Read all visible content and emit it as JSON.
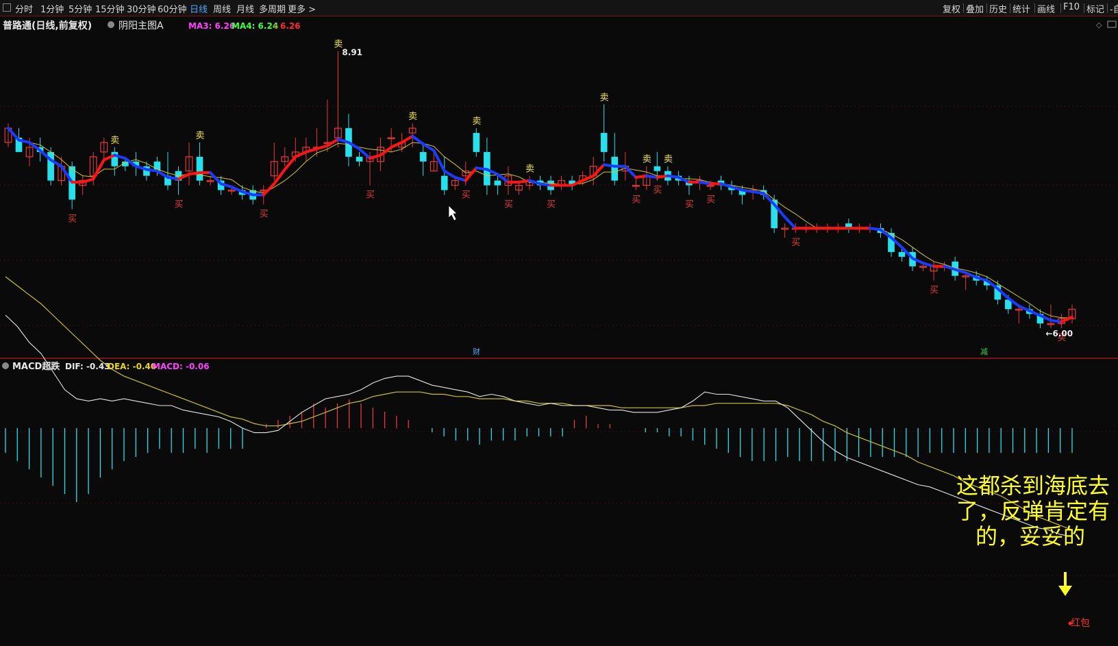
{
  "toolbar": {
    "periods": [
      "分时",
      "1分钟",
      "5分钟",
      "15分钟",
      "30分钟",
      "60分钟",
      "日线",
      "周线",
      "月线",
      "多周期",
      "更多 >"
    ],
    "active_period": "日线",
    "right": [
      "复权",
      "叠加",
      "历史",
      "统计",
      "画线",
      "F10",
      "标记",
      "-自"
    ]
  },
  "main_chart": {
    "stock_title": "普路通(日线,前复权)",
    "indicator_name": "阴阳主图A",
    "ma3_label": "MA3: 6.26",
    "ma4_label": "MA4: 6.24",
    "extra_label": ": 6.26",
    "high_label": "8.91",
    "low_label": "6.00",
    "event_markers": [
      "财",
      "减"
    ]
  },
  "sub_chart": {
    "indicator_name": "MACD超跌",
    "dif_label": "DIF: -0.43",
    "dea_label": "DEA: -0.40",
    "macd_label": "MACD: -0.06",
    "annotation": [
      "这都杀到海底去",
      "了，反弹肯定有",
      "的，妥妥的"
    ],
    "red_packet_label": "红包"
  },
  "colors": {
    "up": "#e8383b",
    "down": "#28e0ec",
    "bull_line": "#ff1414",
    "bear_line": "#1a3cff",
    "ma": "#d9c422",
    "buy": "#e8383b",
    "sell": "#f1e43a",
    "dif": "#e6e6e6",
    "dea": "#d2c21a",
    "ma3": "#ff40ff",
    "ma4": "#3dff3d",
    "grid": "#6b1010",
    "annotation": "#ffff00"
  },
  "chart_data": [
    {
      "type": "candlestick",
      "title": "普路通(日线,前复权)",
      "ohlc": [
        [
          7.95,
          8.1,
          7.9,
          8.15
        ],
        [
          8.0,
          7.85,
          7.9,
          8.1
        ],
        [
          7.8,
          7.9,
          7.7,
          8.0
        ],
        [
          7.9,
          7.85,
          7.75,
          8.0
        ],
        [
          7.85,
          7.55,
          7.5,
          7.9
        ],
        [
          7.55,
          7.7,
          7.5,
          7.8
        ],
        [
          7.7,
          7.35,
          7.25,
          7.75
        ],
        [
          7.5,
          7.55,
          7.4,
          7.6
        ],
        [
          7.6,
          7.8,
          7.5,
          7.85
        ],
        [
          7.85,
          7.95,
          7.75,
          8.0
        ],
        [
          7.85,
          7.7,
          7.6,
          7.9
        ],
        [
          7.75,
          7.7,
          7.65,
          7.8
        ],
        [
          7.75,
          7.7,
          7.6,
          7.85
        ],
        [
          7.7,
          7.6,
          7.55,
          7.75
        ],
        [
          7.75,
          7.65,
          7.6,
          7.8
        ],
        [
          7.6,
          7.5,
          7.45,
          7.85
        ],
        [
          7.65,
          7.55,
          7.4,
          7.7
        ],
        [
          7.65,
          7.8,
          7.5,
          7.95
        ],
        [
          7.8,
          7.55,
          7.5,
          7.95
        ],
        [
          7.55,
          7.55,
          7.5,
          7.6
        ],
        [
          7.55,
          7.45,
          7.4,
          7.6
        ],
        [
          7.45,
          7.45,
          7.4,
          7.5
        ],
        [
          7.45,
          7.4,
          7.35,
          7.5
        ],
        [
          7.45,
          7.35,
          7.3,
          7.5
        ],
        [
          7.45,
          7.45,
          7.3,
          7.5
        ],
        [
          7.6,
          7.75,
          7.55,
          7.95
        ],
        [
          7.75,
          7.8,
          7.7,
          7.9
        ],
        [
          7.8,
          7.85,
          7.75,
          8.0
        ],
        [
          7.85,
          7.9,
          7.75,
          8.0
        ],
        [
          7.9,
          7.9,
          7.8,
          8.1
        ],
        [
          7.95,
          7.95,
          7.85,
          8.4
        ],
        [
          8.0,
          8.1,
          7.9,
          8.91
        ],
        [
          8.1,
          7.8,
          7.7,
          8.25
        ],
        [
          7.8,
          7.75,
          7.7,
          7.85
        ],
        [
          7.75,
          7.8,
          7.5,
          7.85
        ],
        [
          7.75,
          7.9,
          7.65,
          8.0
        ],
        [
          8.0,
          8.0,
          7.85,
          8.1
        ],
        [
          7.9,
          7.95,
          7.85,
          8.05
        ],
        [
          8.05,
          8.1,
          7.9,
          8.15
        ],
        [
          7.85,
          7.75,
          7.6,
          7.95
        ],
        [
          7.65,
          7.75,
          7.65,
          7.85
        ],
        [
          7.6,
          7.45,
          7.4,
          7.8
        ],
        [
          7.5,
          7.55,
          7.45,
          7.6
        ],
        [
          7.6,
          7.65,
          7.5,
          7.75
        ],
        [
          8.05,
          7.85,
          7.8,
          8.1
        ],
        [
          7.85,
          7.5,
          7.4,
          8.0
        ],
        [
          7.55,
          7.5,
          7.4,
          7.6
        ],
        [
          7.5,
          7.6,
          7.4,
          7.7
        ],
        [
          7.45,
          7.5,
          7.4,
          7.55
        ],
        [
          7.5,
          7.55,
          7.45,
          7.6
        ],
        [
          7.55,
          7.5,
          7.45,
          7.6
        ],
        [
          7.55,
          7.45,
          7.4,
          7.6
        ],
        [
          7.5,
          7.55,
          7.45,
          7.6
        ],
        [
          7.55,
          7.5,
          7.45,
          7.6
        ],
        [
          7.55,
          7.6,
          7.5,
          7.65
        ],
        [
          7.6,
          7.7,
          7.5,
          7.8
        ],
        [
          8.05,
          7.85,
          7.75,
          8.35
        ],
        [
          7.8,
          7.55,
          7.5,
          8.05
        ],
        [
          7.65,
          7.7,
          7.55,
          7.85
        ],
        [
          7.5,
          7.5,
          7.45,
          7.6
        ],
        [
          7.5,
          7.6,
          7.45,
          7.7
        ],
        [
          7.7,
          7.65,
          7.55,
          7.85
        ],
        [
          7.65,
          7.55,
          7.5,
          7.7
        ],
        [
          7.6,
          7.55,
          7.5,
          7.65
        ],
        [
          7.55,
          7.5,
          7.4,
          7.6
        ],
        [
          7.55,
          7.55,
          7.45,
          7.6
        ],
        [
          7.5,
          7.5,
          7.45,
          7.55
        ],
        [
          7.55,
          7.5,
          7.45,
          7.6
        ],
        [
          7.5,
          7.45,
          7.4,
          7.55
        ],
        [
          7.45,
          7.4,
          7.3,
          7.5
        ],
        [
          7.45,
          7.45,
          7.35,
          7.5
        ],
        [
          7.45,
          7.4,
          7.35,
          7.5
        ],
        [
          7.35,
          7.05,
          7.0,
          7.4
        ],
        [
          7.05,
          7.05,
          6.95,
          7.1
        ],
        [
          7.05,
          7.05,
          7.0,
          7.1
        ],
        [
          7.05,
          7.05,
          7.0,
          7.1
        ],
        [
          7.05,
          7.05,
          7.0,
          7.1
        ],
        [
          7.05,
          7.05,
          7.0,
          7.1
        ],
        [
          7.05,
          7.05,
          7.0,
          7.1
        ],
        [
          7.1,
          7.05,
          7.0,
          7.15
        ],
        [
          7.05,
          7.05,
          7.0,
          7.1
        ],
        [
          7.05,
          7.05,
          7.0,
          7.1
        ],
        [
          7.05,
          7.0,
          6.95,
          7.1
        ],
        [
          7.0,
          6.8,
          6.75,
          7.05
        ],
        [
          6.8,
          6.75,
          6.7,
          6.85
        ],
        [
          6.8,
          6.65,
          6.6,
          6.85
        ],
        [
          6.65,
          6.65,
          6.6,
          6.7
        ],
        [
          6.6,
          6.65,
          6.5,
          6.7
        ],
        [
          6.65,
          6.65,
          6.6,
          6.7
        ],
        [
          6.7,
          6.55,
          6.5,
          6.75
        ],
        [
          6.55,
          6.55,
          6.4,
          6.6
        ],
        [
          6.55,
          6.5,
          6.45,
          6.6
        ],
        [
          6.5,
          6.45,
          6.4,
          6.55
        ],
        [
          6.45,
          6.3,
          6.25,
          6.5
        ],
        [
          6.3,
          6.2,
          6.15,
          6.35
        ],
        [
          6.2,
          6.2,
          6.05,
          6.25
        ],
        [
          6.2,
          6.15,
          6.1,
          6.25
        ],
        [
          6.15,
          6.05,
          6.0,
          6.2
        ],
        [
          6.05,
          6.05,
          6.0,
          6.25
        ],
        [
          6.05,
          6.1,
          6.0,
          6.15
        ],
        [
          6.1,
          6.2,
          6.05,
          6.25
        ]
      ],
      "ylim": [
        5.85,
        9.05
      ],
      "series": [
        {
          "name": "MA3",
          "value": 6.26
        },
        {
          "name": "MA4",
          "value": 6.24
        }
      ],
      "annotations": [
        "8.91",
        "6.00",
        "财",
        "减"
      ]
    },
    {
      "type": "line",
      "title": "MACD超跌",
      "dif": [
        0.55,
        0.5,
        0.43,
        0.38,
        0.3,
        0.22,
        0.18,
        0.17,
        0.18,
        0.17,
        0.18,
        0.17,
        0.16,
        0.15,
        0.15,
        0.13,
        0.12,
        0.11,
        0.1,
        0.08,
        0.05,
        0.03,
        0.03,
        0.04,
        0.08,
        0.12,
        0.15,
        0.18,
        0.19,
        0.2,
        0.22,
        0.25,
        0.27,
        0.28,
        0.28,
        0.26,
        0.24,
        0.23,
        0.22,
        0.21,
        0.19,
        0.2,
        0.19,
        0.17,
        0.16,
        0.15,
        0.16,
        0.15,
        0.15,
        0.15,
        0.14,
        0.13,
        0.13,
        0.12,
        0.12,
        0.12,
        0.13,
        0.14,
        0.17,
        0.21,
        0.2,
        0.2,
        0.19,
        0.18,
        0.17,
        0.17,
        0.14,
        0.09,
        0.04,
        -0.01,
        -0.05,
        -0.08,
        -0.1,
        -0.12,
        -0.14,
        -0.16,
        -0.18,
        -0.2,
        -0.21,
        -0.23,
        -0.25,
        -0.27,
        -0.29,
        -0.31,
        -0.33,
        -0.35,
        -0.37,
        -0.39,
        -0.4,
        -0.42,
        -0.43
      ],
      "dea": [
        0.72,
        0.68,
        0.64,
        0.6,
        0.55,
        0.5,
        0.45,
        0.4,
        0.35,
        0.31,
        0.28,
        0.26,
        0.24,
        0.22,
        0.2,
        0.18,
        0.16,
        0.14,
        0.12,
        0.1,
        0.09,
        0.07,
        0.06,
        0.06,
        0.07,
        0.08,
        0.1,
        0.12,
        0.14,
        0.16,
        0.17,
        0.19,
        0.2,
        0.21,
        0.21,
        0.21,
        0.2,
        0.2,
        0.19,
        0.19,
        0.18,
        0.18,
        0.18,
        0.17,
        0.17,
        0.16,
        0.16,
        0.16,
        0.15,
        0.15,
        0.15,
        0.15,
        0.14,
        0.14,
        0.14,
        0.14,
        0.14,
        0.14,
        0.15,
        0.15,
        0.16,
        0.16,
        0.16,
        0.16,
        0.16,
        0.16,
        0.15,
        0.13,
        0.11,
        0.08,
        0.06,
        0.03,
        0.01,
        -0.01,
        -0.03,
        -0.05,
        -0.07,
        -0.1,
        -0.12,
        -0.14,
        -0.16,
        -0.19,
        -0.21,
        -0.23,
        -0.25,
        -0.28,
        -0.31,
        -0.34,
        -0.36,
        -0.38,
        -0.4
      ],
      "macd": [
        -0.06,
        -0.08,
        -0.1,
        -0.12,
        -0.14,
        -0.16,
        -0.18,
        -0.16,
        -0.12,
        -0.1,
        -0.08,
        -0.07,
        -0.06,
        -0.05,
        -0.06,
        -0.06,
        -0.05,
        -0.06,
        -0.05,
        -0.05,
        -0.05,
        0.0,
        0.01,
        0.02,
        0.03,
        0.04,
        0.06,
        0.05,
        0.06,
        0.07,
        0.06,
        0.05,
        0.04,
        0.03,
        0.02,
        0.0,
        -0.01,
        -0.02,
        -0.03,
        -0.03,
        -0.04,
        -0.03,
        -0.03,
        -0.03,
        -0.02,
        -0.02,
        -0.02,
        -0.02,
        0.02,
        0.03,
        0.01,
        0.01,
        0.0,
        0.0,
        -0.01,
        -0.01,
        -0.02,
        -0.02,
        -0.03,
        -0.04,
        -0.05,
        -0.06,
        -0.07,
        -0.08,
        -0.08,
        -0.08,
        -0.07,
        -0.08,
        -0.08,
        -0.08,
        -0.08,
        -0.08,
        -0.07,
        -0.07,
        -0.07,
        -0.07,
        -0.07,
        -0.07,
        -0.06,
        -0.06,
        -0.06,
        -0.06,
        -0.06,
        -0.06,
        -0.06,
        -0.06,
        -0.06,
        -0.06,
        -0.06,
        -0.06,
        -0.06
      ],
      "ylim": [
        -0.6,
        0.8
      ],
      "annotations": [
        "这都杀到海底去",
        "了，反弹肯定有",
        "的，妥妥的",
        "红包"
      ]
    }
  ]
}
